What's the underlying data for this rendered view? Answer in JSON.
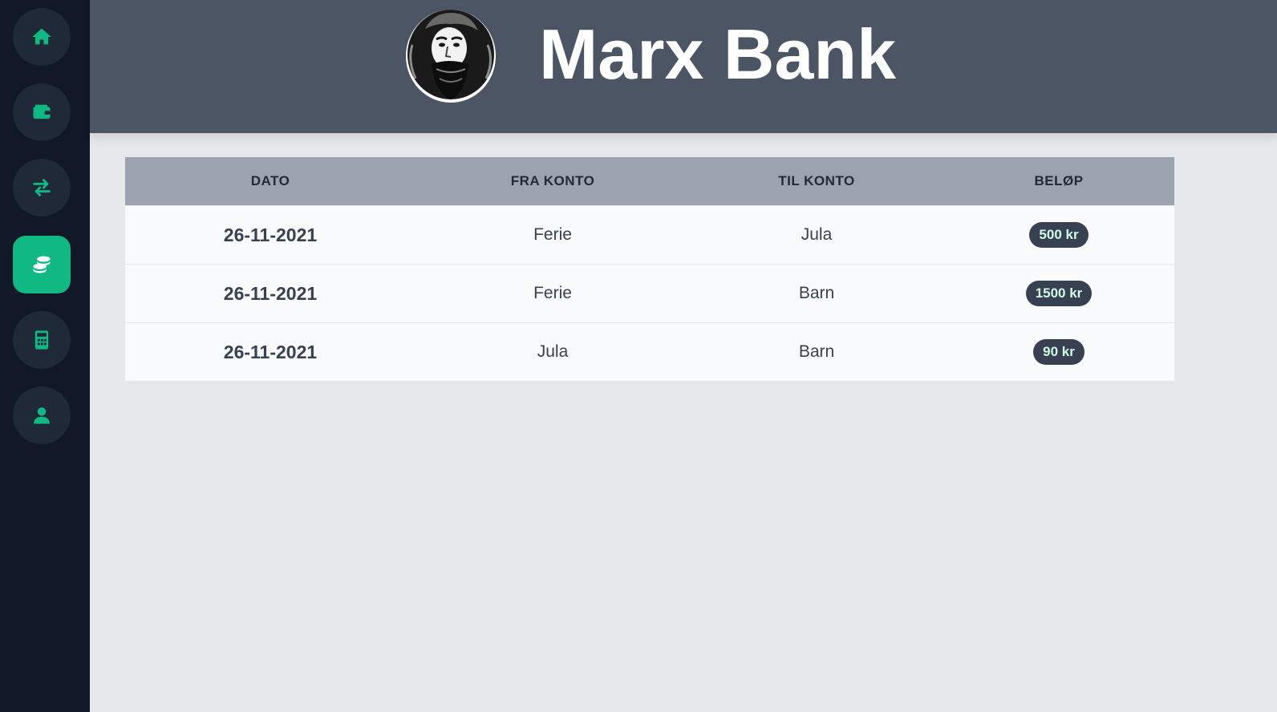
{
  "app": {
    "title": "Marx Bank",
    "accent_color": "#10b981",
    "sidebar_color": "#111827",
    "header_color": "#4b5563"
  },
  "sidebar": {
    "items": [
      {
        "icon": "home-icon",
        "active": false
      },
      {
        "icon": "wallet-icon",
        "active": false
      },
      {
        "icon": "transfer-arrows-icon",
        "active": false
      },
      {
        "icon": "coins-icon",
        "active": true
      },
      {
        "icon": "calculator-icon",
        "active": false
      },
      {
        "icon": "user-icon",
        "active": false
      }
    ]
  },
  "table": {
    "headers": [
      "DATO",
      "FRA KONTO",
      "TIL KONTO",
      "BELØP"
    ],
    "rows": [
      {
        "date": "26-11-2021",
        "from": "Ferie",
        "to": "Jula",
        "amount": "500 kr"
      },
      {
        "date": "26-11-2021",
        "from": "Ferie",
        "to": "Barn",
        "amount": "1500 kr"
      },
      {
        "date": "26-11-2021",
        "from": "Jula",
        "to": "Barn",
        "amount": "90 kr"
      }
    ]
  }
}
